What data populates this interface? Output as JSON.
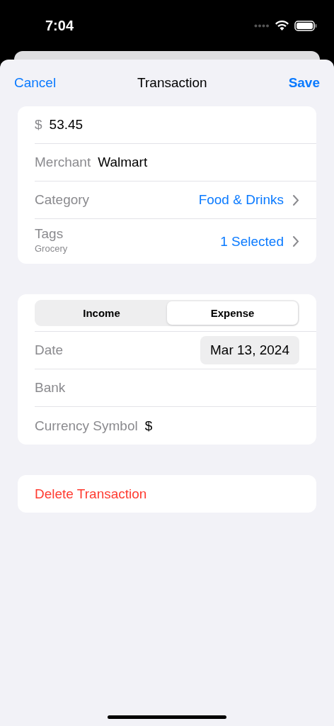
{
  "status_bar": {
    "time": "7:04"
  },
  "nav": {
    "cancel": "Cancel",
    "title": "Transaction",
    "save": "Save"
  },
  "details": {
    "amount": {
      "symbol": "$",
      "value": "53.45"
    },
    "rows": [
      {
        "kind": "field",
        "label": "Merchant",
        "value": "Walmart"
      },
      {
        "kind": "link",
        "label": "Category",
        "value": "Food & Drinks"
      },
      {
        "kind": "link",
        "label": "Tags",
        "subtitle": "Grocery",
        "value": "1 Selected"
      }
    ]
  },
  "type_segment": [
    {
      "label": "Income",
      "selected": false
    },
    {
      "label": "Expense",
      "selected": true
    }
  ],
  "extra_rows": [
    {
      "kind": "date",
      "label": "Date",
      "value": "Mar 13, 2024"
    },
    {
      "kind": "field",
      "label": "Bank"
    },
    {
      "kind": "field",
      "label": "Currency Symbol",
      "value": "$"
    }
  ],
  "delete": {
    "label": "Delete Transaction"
  }
}
